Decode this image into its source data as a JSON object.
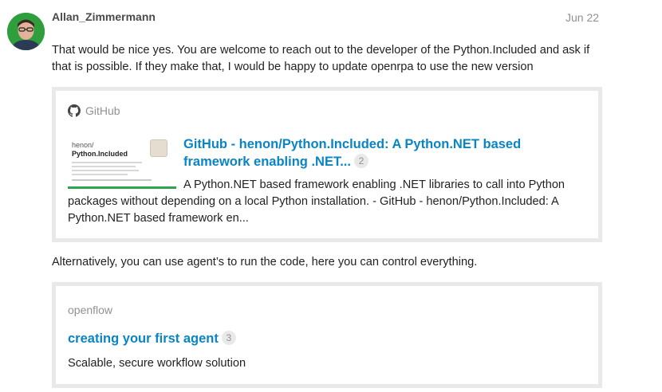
{
  "post": {
    "author": "Allan_Zimmermann",
    "date": "Jun 22",
    "paragraph_1": "That would be nice yes. You are welcome to reach out to the developer of the Python.Included and ask if that is possible. If they make that, I would be happy to update openrpa to use the new version",
    "paragraph_2": "Alternatively, you can use agent’s to run the code, here you can control everything."
  },
  "github_onebox": {
    "source": "GitHub",
    "thumbnail_owner": "henon/",
    "thumbnail_repo": "Python.Included",
    "title": "GitHub - henon/Python.Included: A Python.NET based framework enabling .NET...",
    "click_count": "2",
    "description": "A Python.NET based framework enabling .NET libraries to call into Python packages without depending on a local Python installation. - GitHub - henon/Python.Included: A Python.NET based framework en..."
  },
  "openflow_onebox": {
    "source": "openflow",
    "title": "creating your first agent",
    "click_count": "3",
    "description": "Scalable, secure workflow solution"
  },
  "colors": {
    "link": "#0a84c4",
    "muted": "#919191",
    "border": "#e9e9e9",
    "avatar_bg": "#2f9e3c"
  },
  "icons": {
    "github": "github-icon"
  }
}
